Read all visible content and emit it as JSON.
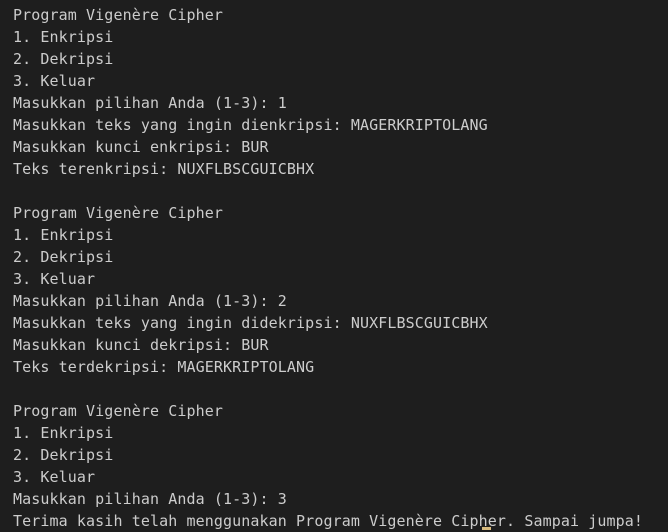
{
  "terminal": {
    "lines": [
      "Program Vigenère Cipher",
      "1. Enkripsi",
      "2. Dekripsi",
      "3. Keluar",
      "Masukkan pilihan Anda (1-3): 1",
      "Masukkan teks yang ingin dienkripsi: MAGERKRIPTOLANG",
      "Masukkan kunci enkripsi: BUR",
      "Teks terenkripsi: NUXFLBSCGUICBHX",
      "",
      "Program Vigenère Cipher",
      "1. Enkripsi",
      "2. Dekripsi",
      "3. Keluar",
      "Masukkan pilihan Anda (1-3): 2",
      "Masukkan teks yang ingin didekripsi: NUXFLBSCGUICBHX",
      "Masukkan kunci dekripsi: BUR",
      "Teks terdekripsi: MAGERKRIPTOLANG",
      "",
      "Program Vigenère Cipher",
      "1. Enkripsi",
      "2. Dekripsi",
      "3. Keluar",
      "Masukkan pilihan Anda (1-3): 3",
      "Terima kasih telah menggunakan Program Vigenère Cipher. Sampai jumpa!"
    ]
  },
  "colors": {
    "background": "#1e1e1e",
    "text": "#cccccc",
    "cursor": "#d7ba7d"
  }
}
